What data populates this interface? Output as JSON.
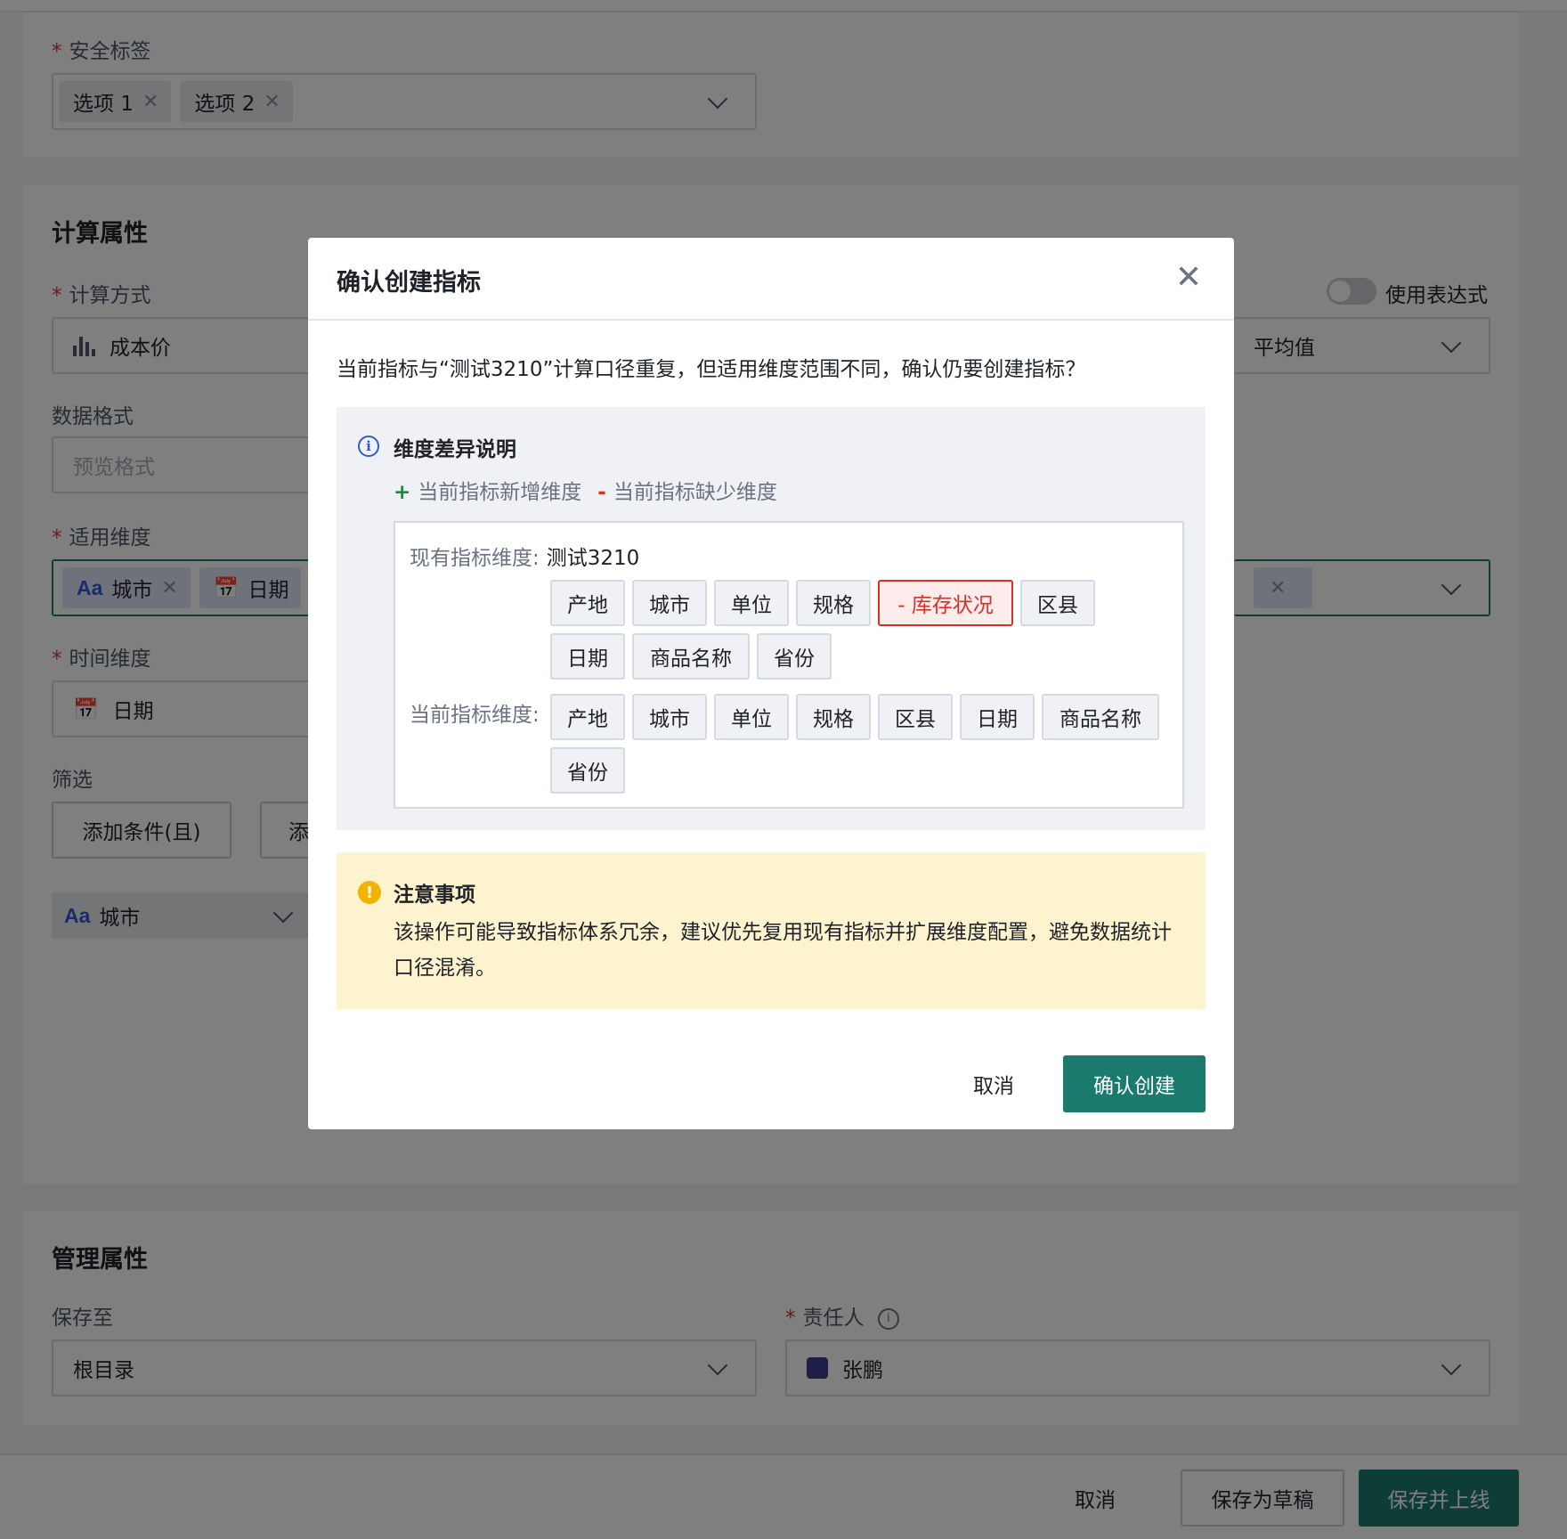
{
  "form": {
    "security_tags": {
      "label": "安全标签",
      "required_mark": "*",
      "chips": [
        "选项 1",
        "选项 2"
      ]
    },
    "calc_section": {
      "title": "计算属性",
      "calc_method_label": "计算方式",
      "calc_method_value": "成本价",
      "use_expression_label": "使用表达式",
      "aggregation_value": "平均值",
      "data_format_label": "数据格式",
      "data_format_placeholder": "预览格式",
      "dimensions_label": "适用维度",
      "dimension_chips": [
        "城市",
        "日期"
      ],
      "time_dim_label": "时间维度",
      "time_dim_value": "日期",
      "filter_label": "筛选",
      "add_and_button": "添加条件(且)",
      "add_or_button": "添",
      "filter_field_value": "城市",
      "aa_text": "Aa"
    },
    "mgmt_section": {
      "title": "管理属性",
      "save_to_label": "保存至",
      "save_to_value": "根目录",
      "owner_label": "责任人",
      "owner_value": "张鹏"
    },
    "footer": {
      "cancel": "取消",
      "save_draft": "保存为草稿",
      "save_online": "保存并上线"
    }
  },
  "modal": {
    "title": "确认创建指标",
    "message": "当前指标与“测试3210”计算口径重复，但适用维度范围不同，确认仍要创建指标？",
    "diff": {
      "title": "维度差异说明",
      "legend_add_symbol": "+",
      "legend_add": "当前指标新增维度",
      "legend_remove_symbol": "-",
      "legend_remove": "当前指标缺少维度",
      "existing_label": "现有指标维度:",
      "existing_name": "测试3210",
      "existing_tags": [
        "产地",
        "城市",
        "单位",
        "规格",
        "- 库存状况",
        "区县",
        "日期",
        "商品名称",
        "省份"
      ],
      "current_label": "当前指标维度:",
      "current_tags": [
        "产地",
        "城市",
        "单位",
        "规格",
        "区县",
        "日期",
        "商品名称",
        "省份"
      ]
    },
    "notice": {
      "title": "注意事项",
      "text": "该操作可能导致指标体系冗余，建议优先复用现有指标并扩展维度配置，避免数据统计口径混淆。"
    },
    "cancel": "取消",
    "confirm": "确认创建"
  },
  "colors": {
    "primary": "#1a7a6d",
    "danger": "#d93026",
    "info": "#2e5bd8",
    "warning": "#f0b400"
  }
}
